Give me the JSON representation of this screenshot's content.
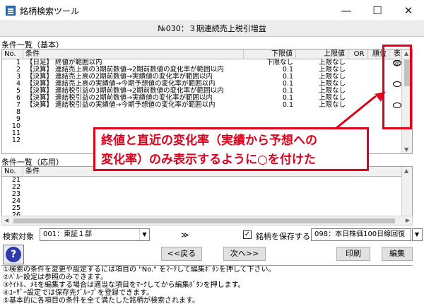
{
  "window": {
    "title": "銘柄検索ツール",
    "minimize": "—",
    "maximize": "☐",
    "close": "✕"
  },
  "header": {
    "title": "№030：３期連続売上税引増益"
  },
  "basic": {
    "section_label": "条件一覧（基本）",
    "columns": {
      "no": "No.",
      "cond": "条件",
      "lo": "下限値",
      "hi": "上限値",
      "or": "OR",
      "rank": "順位",
      "show": "表示"
    },
    "rows": [
      {
        "no": "1",
        "cond": "【日足】 終値が範囲以内",
        "lo": "下限なし",
        "hi": "上限なし",
        "show": true
      },
      {
        "no": "2",
        "cond": "【決算】 連結売上高の3期前数値→2期前数値の変化率が範囲以内",
        "lo": "0.1",
        "hi": "上限なし",
        "show": false
      },
      {
        "no": "3",
        "cond": "【決算】 連結売上高の2期前数値→実績値の変化率が範囲以内",
        "lo": "0.1",
        "hi": "上限なし",
        "show": false
      },
      {
        "no": "4",
        "cond": "【決算】 連結売上高の実績値→今期予想値の変化率が範囲以内",
        "lo": "0.1",
        "hi": "上限なし",
        "show": true
      },
      {
        "no": "5",
        "cond": "【決算】 連結税引益の3期前数値→2期前数値の変化率が範囲以内",
        "lo": "0.1",
        "hi": "上限なし",
        "show": false
      },
      {
        "no": "6",
        "cond": "【決算】 連結税引益の2期前数値→実績値の変化率が範囲以内",
        "lo": "0.1",
        "hi": "上限なし",
        "show": false
      },
      {
        "no": "7",
        "cond": "【決算】 連結税引益の実績値→今期予想値の変化率が範囲以内",
        "lo": "0.1",
        "hi": "上限なし",
        "show": true
      },
      {
        "no": "8",
        "cond": "",
        "lo": "",
        "hi": "",
        "show": false
      },
      {
        "no": "9",
        "cond": "",
        "lo": "",
        "hi": "",
        "show": false
      },
      {
        "no": "10",
        "cond": "",
        "lo": "",
        "hi": "",
        "show": false
      },
      {
        "no": "11",
        "cond": "",
        "lo": "",
        "hi": "",
        "show": false
      },
      {
        "no": "12",
        "cond": "",
        "lo": "",
        "hi": "",
        "show": false
      }
    ]
  },
  "applied": {
    "section_label": "条件一覧（応用）",
    "columns": {
      "no": "No.",
      "cond": "条件"
    },
    "rows": [
      {
        "no": "21"
      },
      {
        "no": "22"
      },
      {
        "no": "23"
      },
      {
        "no": "24"
      },
      {
        "no": "25"
      },
      {
        "no": "26"
      }
    ]
  },
  "callout": {
    "line1": "終値と直近の変化率（実績から予想への",
    "line2": "変化率）のみ表示するように○を付けた"
  },
  "controls": {
    "search_target_label": "検索対象",
    "search_target_value": "001：東証１部",
    "nav_arrows": "≫",
    "save_label": "銘柄を保存する",
    "save_checked": "✓",
    "save_target_value": "098：本日株価100日線回復",
    "prev_button": "<<戻る",
    "next_button": "次へ>>",
    "print_button": "印刷",
    "edit_button": "編集",
    "help_glyph": "?"
  },
  "instructions": [
    "①検索の条件を変更や設定するには項目の \"No.\" をﾏｰｸして編集ﾎﾞﾀﾝを押して下さい。",
    "②ﾊﾞﾙｰ設定は参照のみできます。",
    "③ｹｲﾄﾙ、ﾒﾓを編集する場合は適当な項目をﾏｰｸしてから編集ﾎﾞﾀﾝを押します。",
    "④ﾕｰｻﾞｰ設定では保存先ｸﾞﾙｰﾌﾟを登録できます。",
    "⑤基本的に各項目の条件を全て満たした銘柄が検索されます。"
  ],
  "colors": {
    "annotation_red": "#e0001b",
    "header_bg": "#ececec"
  }
}
